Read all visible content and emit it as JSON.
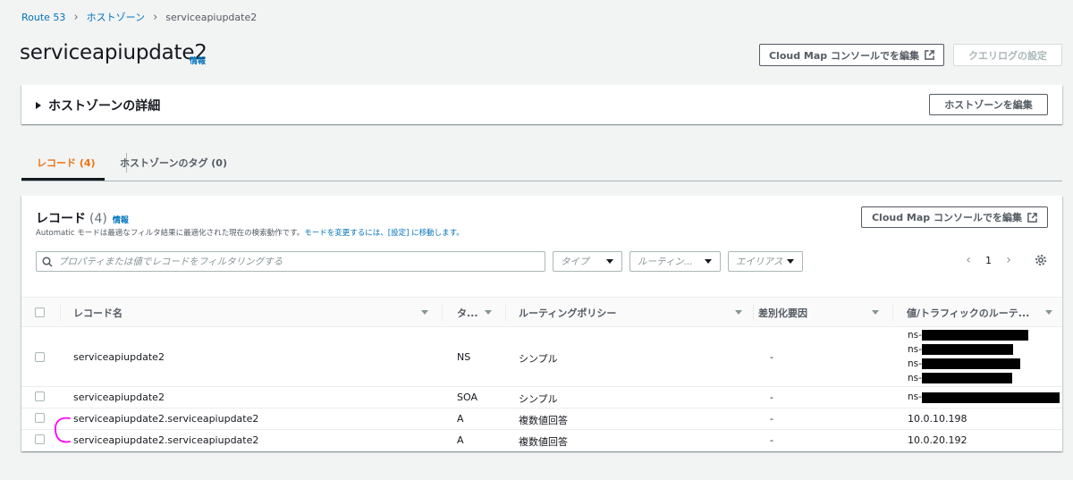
{
  "breadcrumb": {
    "items": [
      "Route 53",
      "ホストゾーン"
    ],
    "current": "serviceapiupdate2"
  },
  "page": {
    "title": "serviceapiupdate2",
    "info": "情報",
    "cloud_map_button": "Cloud Map コンソールでを編集",
    "query_log_button": "クエリログの設定"
  },
  "details": {
    "title": "ホストゾーンの詳細",
    "edit_button": "ホストゾーンを編集"
  },
  "tabs": {
    "records": "レコード (4)",
    "tags": "ホストゾーンのタグ (0)"
  },
  "records": {
    "title": "レコード",
    "count": "(4)",
    "info": "情報",
    "desc_prefix": "Automatic モードは最適なフィルタ結果に最適化された現在の検索動作です。",
    "desc_link": "モードを変更するには、[設定] に移動します。",
    "cloud_map_button": "Cloud Map コンソールでを編集",
    "filter_placeholder": "プロパティまたは値でレコードをフィルタリングする",
    "type_select": "タイプ",
    "routing_select": "ルーティン...",
    "alias_select": "エイリアス",
    "page": "1",
    "columns": [
      "レコード名",
      "タ...",
      "ルーティングポリシー",
      "差別化要因",
      "値/トラフィックのルーテ..."
    ],
    "rows": [
      {
        "name": "serviceapiupdate2",
        "type": "NS",
        "policy": "シンプル",
        "diff": "-",
        "values": [
          "ns-",
          "ns-",
          "ns-",
          "ns-"
        ]
      },
      {
        "name": "serviceapiupdate2",
        "type": "SOA",
        "policy": "シンプル",
        "diff": "-",
        "values": [
          "ns-"
        ]
      },
      {
        "name": "serviceapiupdate2.serviceapiupdate2",
        "type": "A",
        "policy": "複数値回答",
        "diff": "-",
        "values": [
          "10.0.10.198"
        ]
      },
      {
        "name": "serviceapiupdate2.serviceapiupdate2",
        "type": "A",
        "policy": "複数値回答",
        "diff": "-",
        "values": [
          "10.0.20.192"
        ]
      }
    ]
  },
  "colors": {
    "link": "#0073bb",
    "active_tab": "#ec7211",
    "annotation": "#ff00ff"
  }
}
